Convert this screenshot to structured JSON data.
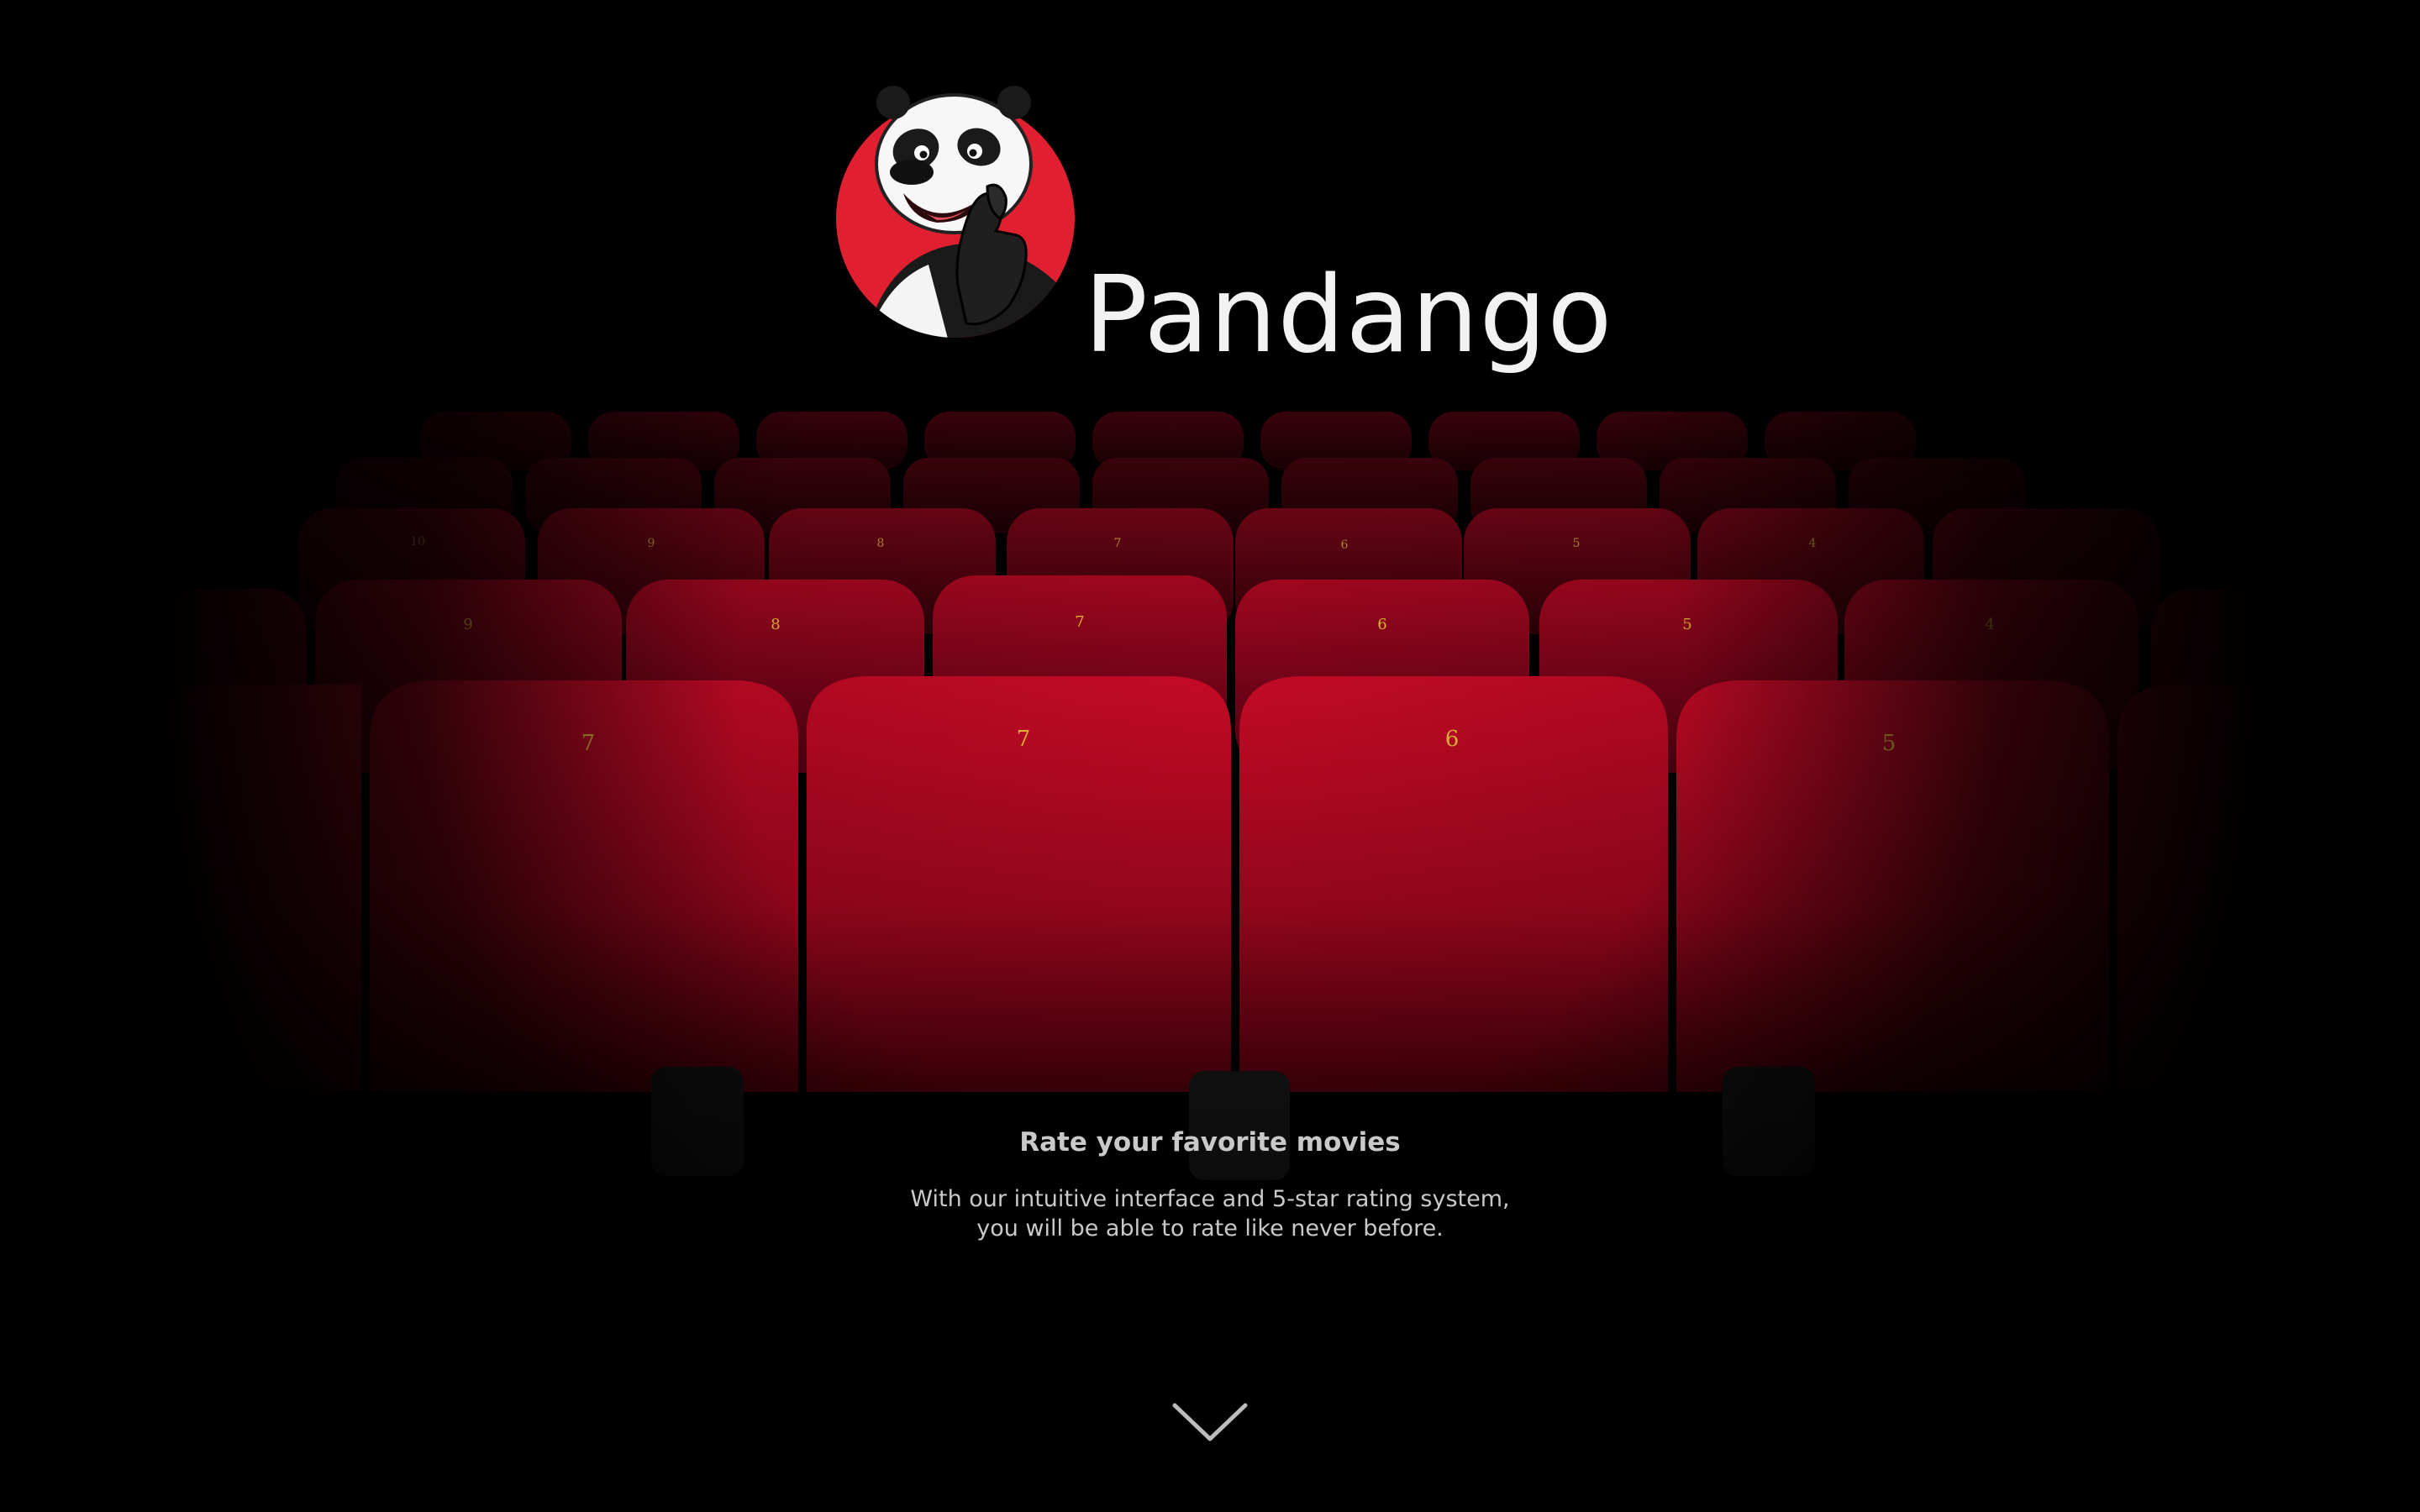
{
  "brand": {
    "name": "Pandango",
    "logo_icon": "panda-thumbs-up-icon"
  },
  "hero": {
    "background": "red-cinema-seats",
    "seat_numbers": {
      "front_row": [
        "7",
        "7",
        "6",
        "5"
      ],
      "middle_row": [
        "9",
        "8",
        "7",
        "6",
        "5",
        "4"
      ],
      "back_row": [
        "10",
        "9",
        "8",
        "7",
        "6",
        "5",
        "4"
      ]
    },
    "tagline_title": "Rate your favorite movies",
    "tagline_description": "With our intuitive interface and 5-star rating system, you will be able to rate like never before.",
    "scroll_icon": "chevron-down-icon"
  },
  "colors": {
    "background": "#000000",
    "seat_red": "#b3001f",
    "brand_text": "#f2f2f2",
    "tagline_text": "#c9c9c9",
    "logo_red": "#e02030"
  }
}
